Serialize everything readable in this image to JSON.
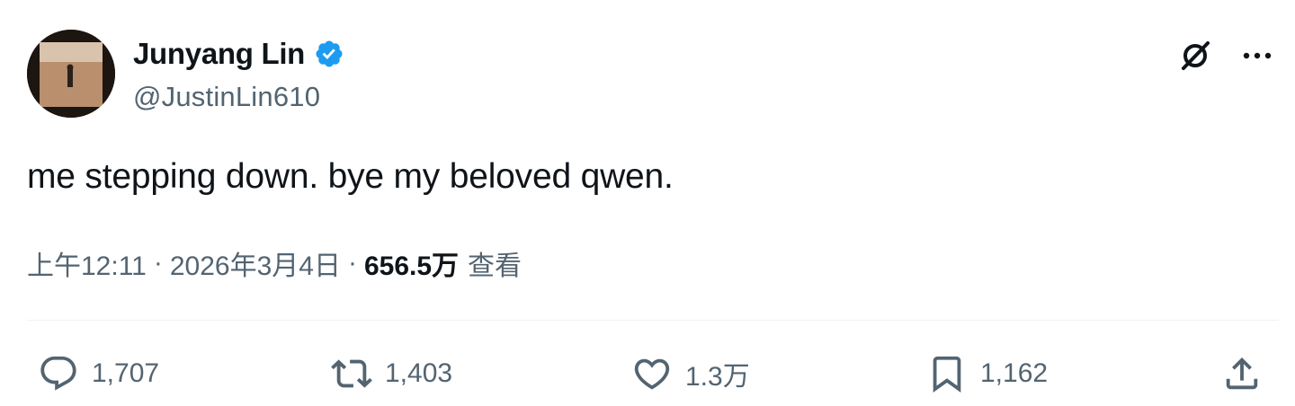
{
  "author": {
    "display_name": "Junyang Lin",
    "handle": "@JustinLin610",
    "verified": true,
    "verified_color": "#1d9bf0"
  },
  "header_icons": {
    "grok": "grok-icon",
    "more": "more-icon"
  },
  "tweet": {
    "text": "me stepping down. bye my beloved qwen."
  },
  "meta": {
    "time": "上午12:11",
    "separator": "·",
    "date": "2026年3月4日",
    "views_count": "656.5万",
    "views_label": "查看"
  },
  "actions": {
    "reply": {
      "icon": "reply-icon",
      "count": "1,707"
    },
    "retweet": {
      "icon": "retweet-icon",
      "count": "1,403"
    },
    "like": {
      "icon": "heart-icon",
      "count": "1.3万"
    },
    "bookmark": {
      "icon": "bookmark-icon",
      "count": "1,162"
    },
    "share": {
      "icon": "share-icon"
    }
  },
  "colors": {
    "text_primary": "#0f1419",
    "text_secondary": "#536471",
    "divider": "#eff3f4"
  }
}
